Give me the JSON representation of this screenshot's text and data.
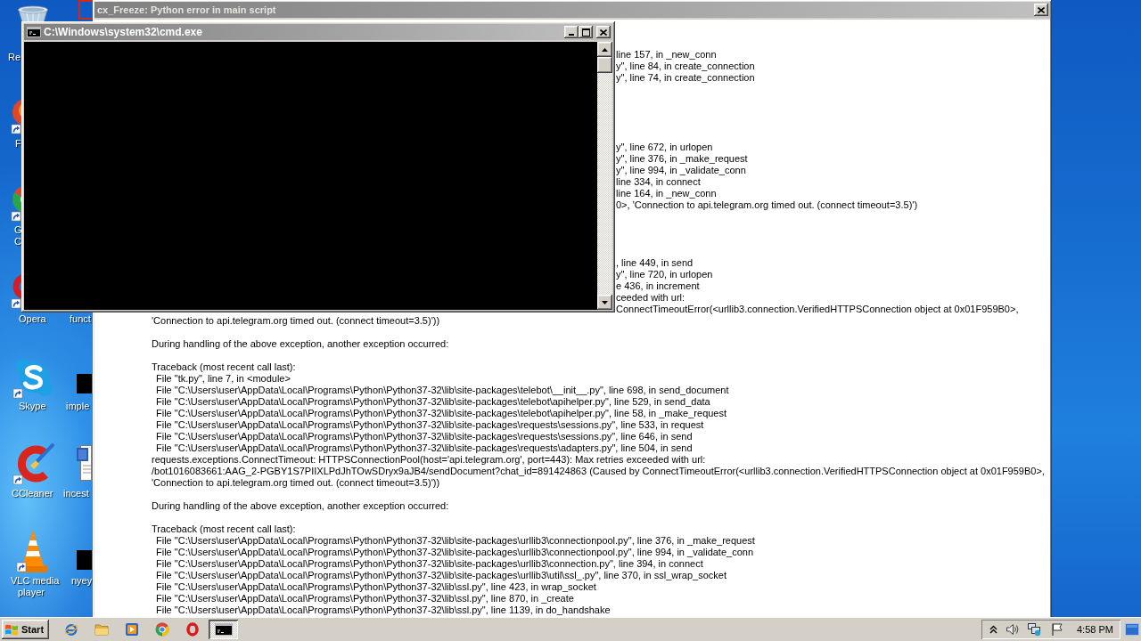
{
  "desktop": {
    "icons": [
      {
        "kind": "bin",
        "label_lines": [
          "Re"
        ]
      },
      {
        "kind": "sphere",
        "label_lines": [
          "F"
        ]
      },
      {
        "kind": "wheel",
        "label_lines": [
          "G",
          "C"
        ]
      },
      {
        "kind": "ring",
        "label_lines": [
          "Opera"
        ]
      },
      {
        "kind": "cloud",
        "label_lines": [
          "Skype"
        ]
      },
      {
        "kind": "brush",
        "label_lines": [
          "CCleaner"
        ]
      },
      {
        "kind": "cone",
        "label_lines": [
          "VLC media",
          "player"
        ]
      },
      {
        "kind": "frame"
      },
      {
        "label_lines": [
          "funct"
        ]
      },
      {
        "kind": "square",
        "label_lines": [
          "imple"
        ]
      },
      {
        "kind": "document",
        "label_lines": [
          "incest"
        ]
      },
      {
        "kind": "square",
        "label_lines": [
          "nyey"
        ]
      }
    ]
  },
  "error_window": {
    "title": "cx_Freeze: Python error in main script",
    "covered_lines": [
      [
        "line 157, in _new_conn",
        "y\", line 84, in create_connection",
        "y\", line 74, in create_connection"
      ],
      [
        "y\", line 672, in urlopen",
        "y\", line 376, in _make_request",
        "y\", line 994, in _validate_conn",
        "line 334, in connect",
        "line 164, in _new_conn",
        "0>, 'Connection to api.telegram.org timed out. (connect timeout=3.5)')"
      ],
      [
        ", line 449, in send",
        "y\", line 720, in urlopen",
        "e 436, in increment",
        "ceeded with url:",
        "ConnectTimeoutError(<urllib3.connection.VerifiedHTTPSConnection object at 0x01F959B0>,"
      ]
    ],
    "output": [
      {
        "kind": "text",
        "lines": [
          "'Connection to api.telegram.org timed out. (connect timeout=3.5)'))"
        ]
      },
      {
        "kind": "text",
        "lines": [
          "During handling of the above exception, another exception occurred:"
        ]
      },
      {
        "kind": "traceback",
        "heading": "Traceback (most recent call last):",
        "frames": [
          "File \"tk.py\", line 7, in <module>",
          "File \"C:\\Users\\user\\AppData\\Local\\Programs\\Python\\Python37-32\\lib\\site-packages\\telebot\\__init__.py\", line 698, in send_document",
          "File \"C:\\Users\\user\\AppData\\Local\\Programs\\Python\\Python37-32\\lib\\site-packages\\telebot\\apihelper.py\", line 529, in send_data",
          "File \"C:\\Users\\user\\AppData\\Local\\Programs\\Python\\Python37-32\\lib\\site-packages\\telebot\\apihelper.py\", line 58, in _make_request",
          "File \"C:\\Users\\user\\AppData\\Local\\Programs\\Python\\Python37-32\\lib\\site-packages\\requests\\sessions.py\", line 533, in request",
          "File \"C:\\Users\\user\\AppData\\Local\\Programs\\Python\\Python37-32\\lib\\site-packages\\requests\\sessions.py\", line 646, in send",
          "File \"C:\\Users\\user\\AppData\\Local\\Programs\\Python\\Python37-32\\lib\\site-packages\\requests\\adapters.py\", line 504, in send"
        ],
        "lines": [
          "requests.exceptions.ConnectTimeout: HTTPSConnectionPool(host='api.telegram.org', port=443): Max retries exceeded with url:",
          "/bot1016083661:AAG_2-PGBY1S7PIIXLPdJhTOwSDryx9aJB4/sendDocument?chat_id=891424863 (Caused by ConnectTimeoutError(<urllib3.connection.VerifiedHTTPSConnection object at 0x01F959B0>,",
          "'Connection to api.telegram.org timed out. (connect timeout=3.5)'))"
        ]
      },
      {
        "kind": "text",
        "lines": [
          "During handling of the above exception, another exception occurred:"
        ]
      },
      {
        "kind": "traceback",
        "heading": "Traceback (most recent call last):",
        "frames": [
          "File \"C:\\Users\\user\\AppData\\Local\\Programs\\Python\\Python37-32\\lib\\site-packages\\urllib3\\connectionpool.py\", line 376, in _make_request",
          "File \"C:\\Users\\user\\AppData\\Local\\Programs\\Python\\Python37-32\\lib\\site-packages\\urllib3\\connectionpool.py\", line 994, in _validate_conn",
          "File \"C:\\Users\\user\\AppData\\Local\\Programs\\Python\\Python37-32\\lib\\site-packages\\urllib3\\connection.py\", line 394, in connect",
          "File \"C:\\Users\\user\\AppData\\Local\\Programs\\Python\\Python37-32\\lib\\site-packages\\urllib3\\util\\ssl_.py\", line 370, in ssl_wrap_socket",
          "File \"C:\\Users\\user\\AppData\\Local\\Programs\\Python\\Python37-32\\lib\\ssl.py\", line 423, in wrap_socket",
          "File \"C:\\Users\\user\\AppData\\Local\\Programs\\Python\\Python37-32\\lib\\ssl.py\", line 870, in _create",
          "File \"C:\\Users\\user\\AppData\\Local\\Programs\\Python\\Python37-32\\lib\\ssl.py\", line 1139, in do_handshake"
        ]
      }
    ]
  },
  "console_window": {
    "title": "C:\\Windows\\system32\\cmd.exe"
  },
  "taskbar": {
    "start": "Start",
    "tasks": [
      {
        "selected": true
      }
    ],
    "clock": "4:58 PM"
  }
}
